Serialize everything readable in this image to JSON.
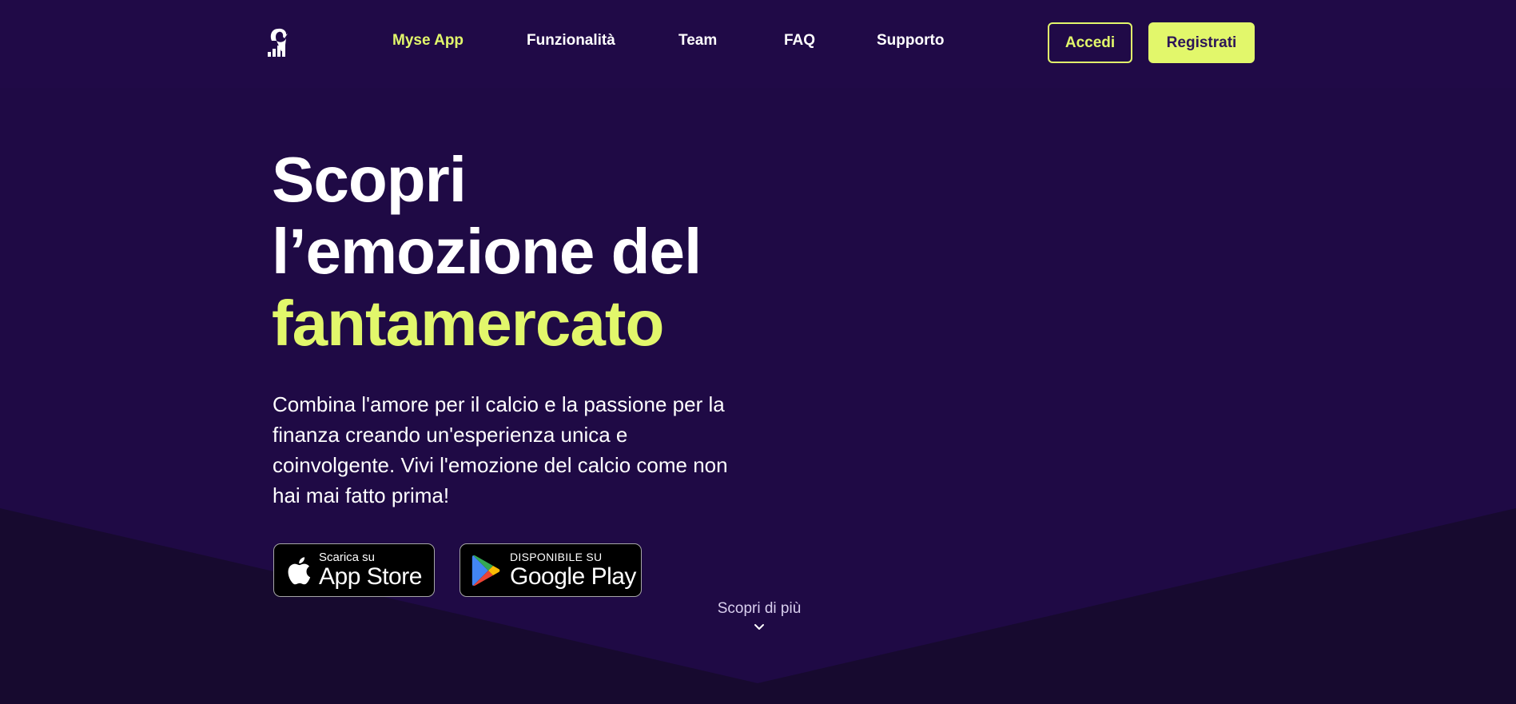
{
  "colors": {
    "background": "#1f0a45",
    "background_lower": "#170a2f",
    "accent": "#e2f76b",
    "button_text_dark": "#2d1658"
  },
  "nav": {
    "logo_icon": "bird-chart-logo-icon",
    "links": [
      {
        "label": "Myse App",
        "active": true
      },
      {
        "label": "Funzionalità",
        "active": false
      },
      {
        "label": "Team",
        "active": false
      },
      {
        "label": "FAQ",
        "active": false
      },
      {
        "label": "Supporto",
        "active": false
      }
    ],
    "login_label": "Accedi",
    "register_label": "Registrati"
  },
  "hero": {
    "title_line1": "Scopri",
    "title_line2": "l’emozione del",
    "title_accent": "fantamercato",
    "description": "Combina l'amore per il calcio e la passione per la finanza creando un'esperienza unica e coinvolgente. Vivi l'emozione del calcio come non hai mai fatto prima!"
  },
  "stores": {
    "apple": {
      "icon": "apple-icon",
      "small": "Scarica su",
      "big": "App Store"
    },
    "google": {
      "icon": "google-play-icon",
      "small": "DISPONIBILE SU",
      "big": "Google Play"
    }
  },
  "scroll": {
    "label": "Scopri di più",
    "icon": "chevron-down-icon"
  }
}
